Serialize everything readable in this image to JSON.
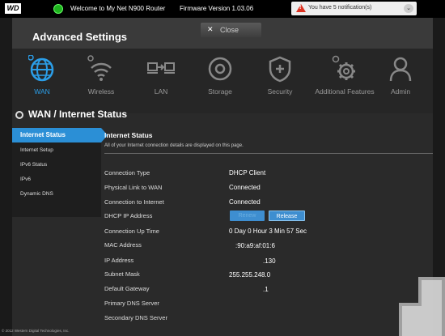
{
  "topbar": {
    "logo": "WD",
    "welcome": "Welcome to My Net N900 Router",
    "firmware": "Firmware Version 1.03.06",
    "notification": "You have 5 notification(s)",
    "caret_icon": "chevron-down-icon"
  },
  "panel": {
    "title": "Advanced Settings",
    "close_label": "Close"
  },
  "nav": [
    {
      "label": "WAN",
      "icon": "globe-icon",
      "active": true
    },
    {
      "label": "Wireless",
      "icon": "wifi-icon",
      "active": false
    },
    {
      "label": "LAN",
      "icon": "lan-icon",
      "active": false
    },
    {
      "label": "Storage",
      "icon": "disk-icon",
      "active": false
    },
    {
      "label": "Security",
      "icon": "shield-icon",
      "active": false
    },
    {
      "label": "Additional Features",
      "icon": "gears-icon",
      "active": false
    },
    {
      "label": "Admin",
      "icon": "user-icon",
      "active": false
    }
  ],
  "section": {
    "title": "WAN / Internet Status"
  },
  "sidebar": [
    {
      "label": "Internet Status",
      "active": true
    },
    {
      "label": "Internet Setup",
      "active": false
    },
    {
      "label": "IPv6 Status",
      "active": false
    },
    {
      "label": "IPv6",
      "active": false
    },
    {
      "label": "Dynamic DNS",
      "active": false
    }
  ],
  "content": {
    "title": "Internet Status",
    "description": "All of your Internet connection details are displayed on this page.",
    "rows": [
      {
        "label": "Connection Type",
        "value": "DHCP Client"
      },
      {
        "label": "Physical Link to WAN",
        "value": "Connected"
      },
      {
        "label": "Connection to Internet",
        "value": "Connected"
      },
      {
        "label": "DHCP IP Address",
        "value": ""
      },
      {
        "label": "Connection Up Time",
        "value": "0 Day 0 Hour 3 Min 57 Sec"
      },
      {
        "label": "MAC Address",
        "value": ":90:a9:af:01:6"
      },
      {
        "label": "IP Address",
        "value": ".130"
      },
      {
        "label": "Subnet Mask",
        "value": "255.255.248.0"
      },
      {
        "label": "Default Gateway",
        "value": ".1"
      },
      {
        "label": "Primary DNS Server",
        "value": ""
      },
      {
        "label": "Secondary DNS Server",
        "value": ""
      }
    ],
    "renew_label": "Renew",
    "release_label": "Release"
  },
  "footer": "© 2012 Western Digital Technologies, Inc.",
  "colors": {
    "accent": "#2b8fd6",
    "background": "#1a1a1a",
    "warning": "#dd3322"
  }
}
